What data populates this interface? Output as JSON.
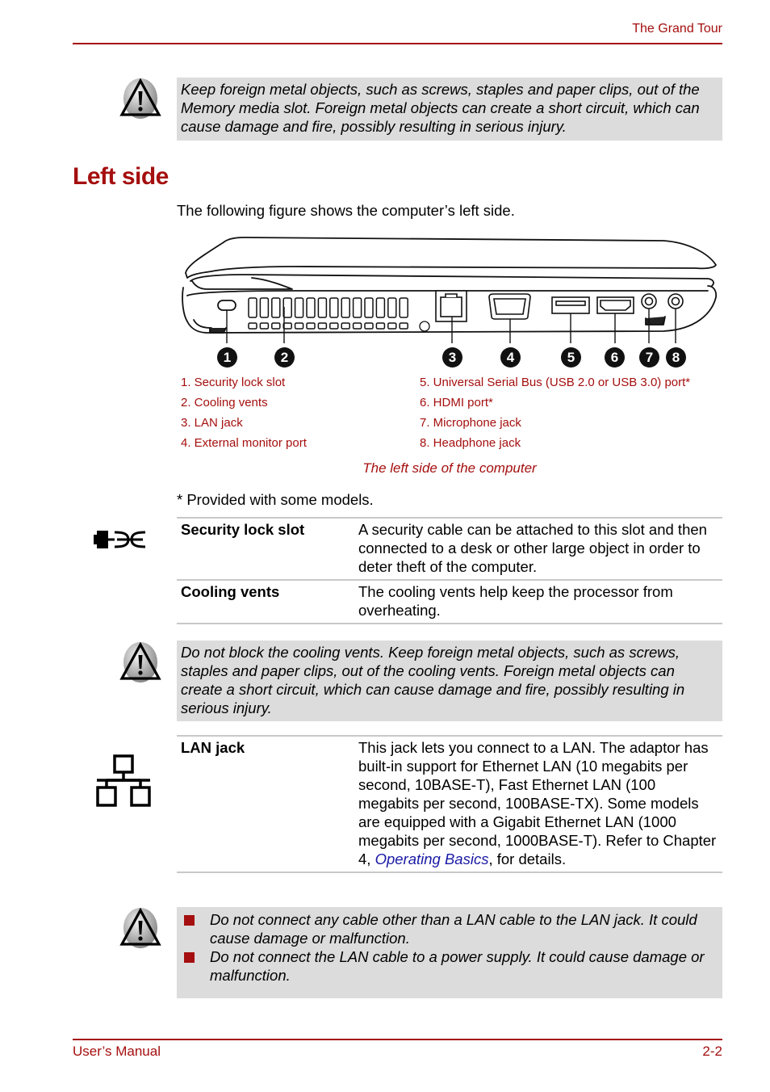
{
  "header": {
    "title": "The Grand Tour"
  },
  "warnings": {
    "memory_slot": "Keep foreign metal objects, such as screws, staples and paper clips, out of the Memory media slot. Foreign metal objects can create a short circuit, which can cause damage and fire, possibly resulting in serious injury.",
    "cooling_vents": "Do not block the cooling vents. Keep foreign metal objects, such as screws, staples and paper clips, out of the cooling vents. Foreign metal objects can create a short circuit, which can cause damage and fire, possibly resulting in serious injury.",
    "lan_bullets": [
      "Do not connect any cable other than a LAN cable to the LAN jack. It could cause damage or malfunction.",
      "Do not connect the LAN cable to a power supply. It could cause damage or malfunction."
    ]
  },
  "section": {
    "title": "Left side",
    "intro": "The following figure shows the computer’s left side."
  },
  "figure": {
    "callouts": [
      "1",
      "2",
      "3",
      "4",
      "5",
      "6",
      "7",
      "8"
    ],
    "legend_left": [
      "1. Security lock slot",
      "2. Cooling vents",
      "3. LAN jack",
      "4. External monitor port"
    ],
    "legend_right": [
      "5. Universal Serial Bus (USB 2.0 or USB 3.0) port*",
      "6. HDMI port*",
      "7. Microphone jack",
      "8. Headphone jack"
    ],
    "caption": "The left side of the computer"
  },
  "footnote": "* Provided with some models.",
  "spec_table_1": [
    {
      "term": "Security lock slot",
      "desc": "A security cable can be attached to this slot and then connected to a desk or other large object in order to deter theft of the computer.",
      "icon": "security-lock-icon"
    },
    {
      "term": "Cooling vents",
      "desc": "The cooling vents help keep the processor from overheating."
    }
  ],
  "spec_table_2": [
    {
      "term": "LAN jack",
      "desc_before": "This jack lets you connect to a LAN. The adaptor has built-in support for Ethernet LAN (10 megabits per second, 10BASE-T), Fast Ethernet LAN (100 megabits per second, 100BASE-TX). Some models are equipped with a Gigabit Ethernet LAN (1000 megabits per second, 1000BASE-T). Refer to Chapter 4, ",
      "link": "Operating Basics",
      "desc_after": ", for details.",
      "icon": "lan-network-icon"
    }
  ],
  "footer": {
    "left": "User’s Manual",
    "right": "2-2"
  },
  "colors": {
    "accent": "#a50f0f",
    "warning_bg": "#dcdcdc",
    "link": "#1a1aa6",
    "divider": "#c8c8c8"
  }
}
